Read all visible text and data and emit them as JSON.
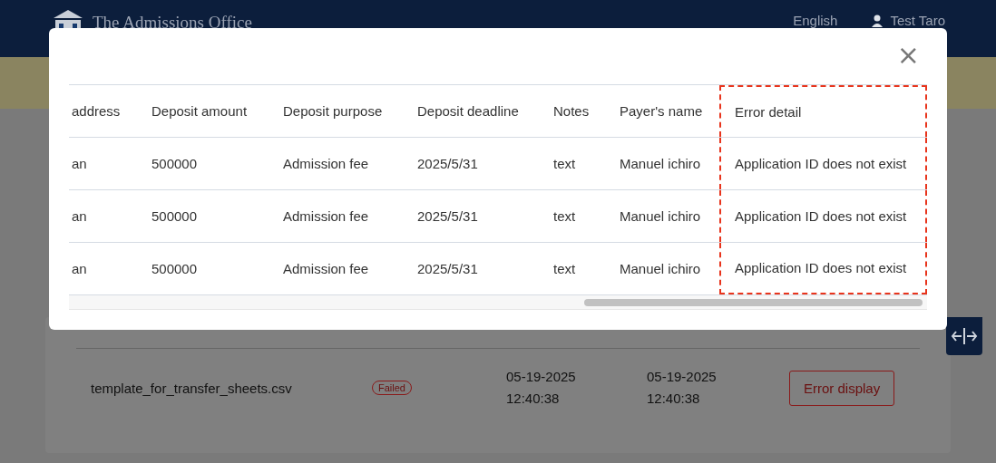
{
  "header": {
    "title": "The Admissions Office",
    "language": "English",
    "user": "Test Taro"
  },
  "upload_row": {
    "file_name": "template_for_transfer_sheets.csv",
    "status": "Failed",
    "started": [
      "05-19-2025",
      "12:40:38"
    ],
    "finished": [
      "05-19-2025",
      "12:40:38"
    ],
    "button": "Error display"
  },
  "error_dialog": {
    "close": "×",
    "columns": [
      {
        "label": "address",
        "highlighted": false
      },
      {
        "label": "Deposit amount",
        "highlighted": false
      },
      {
        "label": "Deposit purpose",
        "highlighted": false
      },
      {
        "label": "Deposit deadline",
        "highlighted": false
      },
      {
        "label": "Notes",
        "highlighted": false
      },
      {
        "label": "Payer's name",
        "highlighted": false
      },
      {
        "label": "Error detail",
        "highlighted": true
      }
    ],
    "rows": [
      [
        "an",
        "500000",
        "Admission fee",
        "2025/5/31",
        "text",
        "Manuel ichiro",
        "Application ID does not exist"
      ],
      [
        "an",
        "500000",
        "Admission fee",
        "2025/5/31",
        "text",
        "Manuel ichiro",
        "Application ID does not exist"
      ],
      [
        "an",
        "500000",
        "Admission fee",
        "2025/5/31",
        "text",
        "Manuel ichiro",
        "Application ID does not exist"
      ]
    ]
  }
}
